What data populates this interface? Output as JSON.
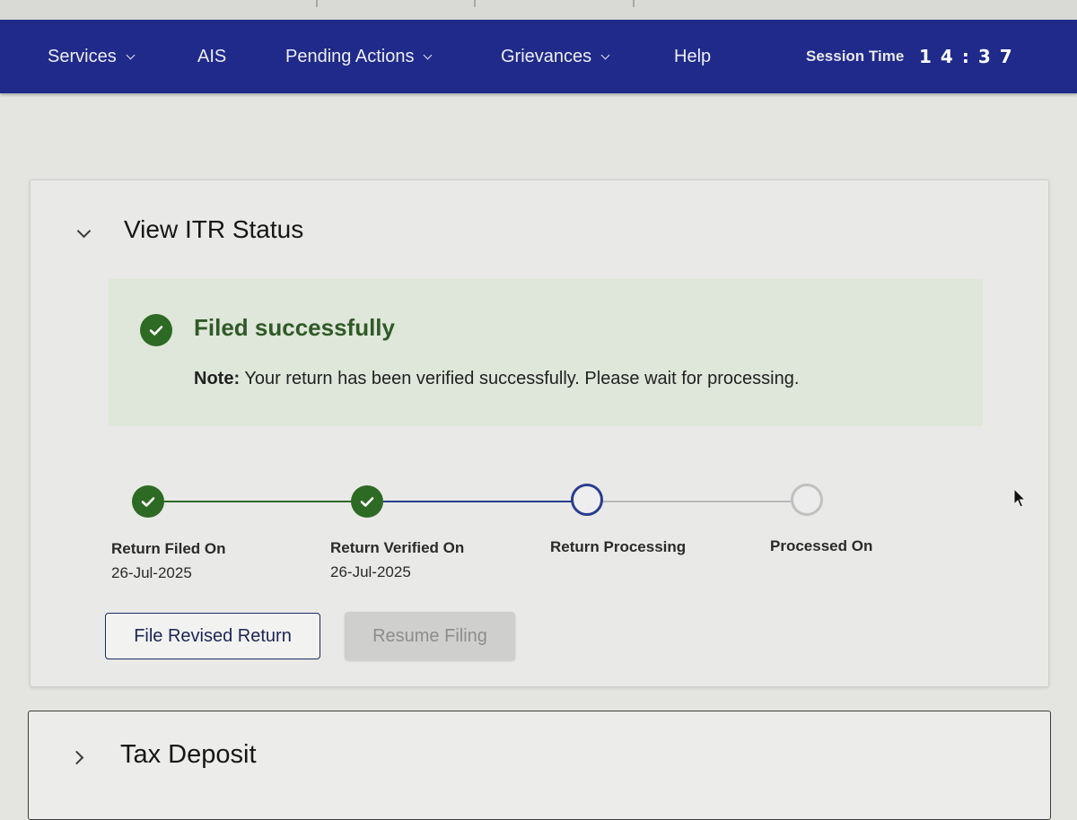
{
  "nav": {
    "items": [
      {
        "label": "Services"
      },
      {
        "label": "AIS"
      },
      {
        "label": "Pending Actions"
      },
      {
        "label": "Grievances"
      },
      {
        "label": "Help"
      }
    ],
    "session_label": "Session Time",
    "session_time": "14:37"
  },
  "itr_status": {
    "title": "View ITR Status",
    "alert": {
      "title": "Filed successfully",
      "note_label": "Note:",
      "note_text": "Your return has been verified successfully. Please wait for processing."
    },
    "steps": [
      {
        "label": "Return Filed On",
        "date": "26-Jul-2025",
        "state": "done"
      },
      {
        "label": "Return Verified On",
        "date": "26-Jul-2025",
        "state": "done"
      },
      {
        "label": "Return Processing",
        "date": "",
        "state": "current"
      },
      {
        "label": "Processed On",
        "date": "",
        "state": "pending"
      }
    ],
    "buttons": {
      "revised": "File Revised Return",
      "resume": "Resume Filing"
    }
  },
  "tax_deposit": {
    "title": "Tax Deposit"
  },
  "colors": {
    "nav_bg": "#1f2a8a",
    "success": "#2d6a23",
    "progress_blue": "#2a3d8e"
  }
}
